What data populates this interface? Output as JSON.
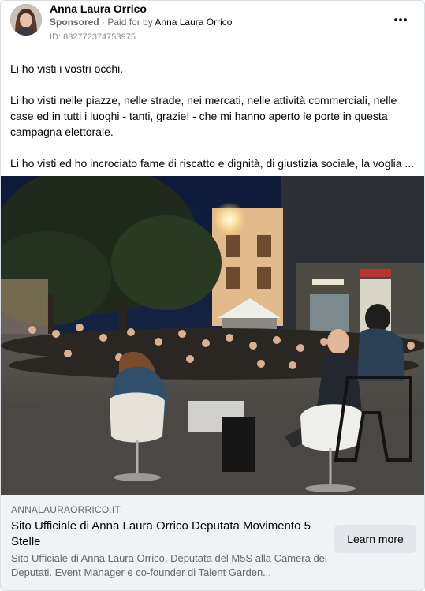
{
  "post": {
    "author_name": "Anna Laura Orrico",
    "sponsored_label": "Sponsored",
    "separator": " · ",
    "paid_for_prefix": "Paid for by ",
    "paid_for_name": "Anna Laura Orrico",
    "ad_id": "ID: 832772374753975",
    "more_icon": "more-horizontal-icon",
    "paragraphs": [
      "Li ho visti i vostri occhi.",
      "Li ho visti nelle piazze, nelle strade, nei mercati, nelle attività commerciali, nelle case ed in tutti i luoghi - tanti, grazie! - che mi hanno aperto le porte in questa campagna elettorale.",
      "Li ho visti ed ho incrociato fame di riscatto e dignità, di giustizia sociale, la voglia ..."
    ]
  },
  "link_preview": {
    "domain": "ANNALAURAORRICO.IT",
    "headline": "Sito Ufficiale di Anna Laura Orrico Deputata Movimento 5 Stelle",
    "description": "Sito Ufficiale di Anna Laura Orrico. Deputata del M5S alla Camera dei Deputati. Event Manager e co-founder di Talent Garden...",
    "cta_label": "Learn more"
  },
  "colors": {
    "text_primary": "#050505",
    "text_secondary": "#65676b",
    "link_bg": "#f0f2f5",
    "button_bg": "#e4e6eb"
  }
}
